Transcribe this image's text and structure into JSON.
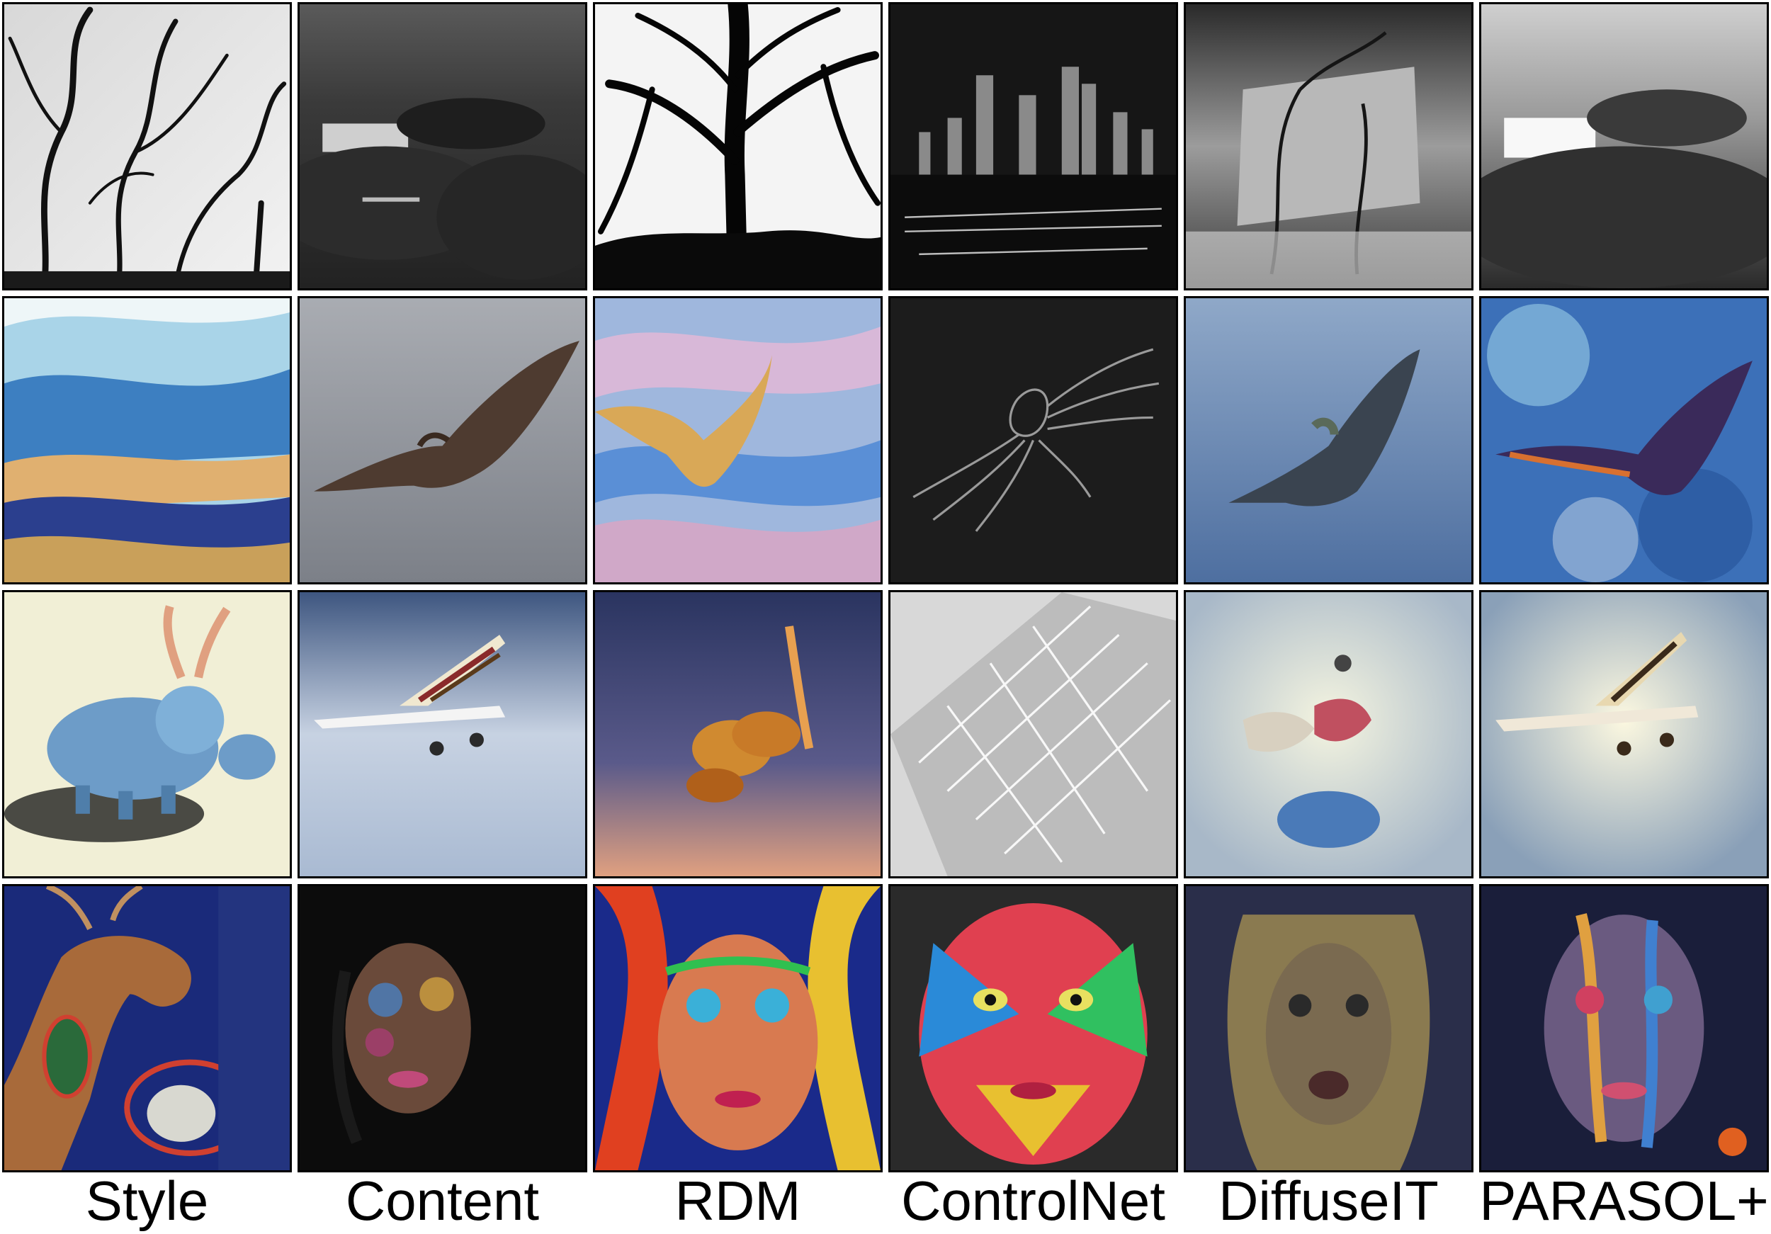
{
  "columns": [
    "Style",
    "Content",
    "RDM",
    "ControlNet",
    "DiffuseIT",
    "PARASOL+"
  ],
  "rows": [
    {
      "cells": [
        {
          "name": "bw-tree-shadows-image"
        },
        {
          "name": "bw-field-billboard-image"
        },
        {
          "name": "bw-tree-silhouette-image"
        },
        {
          "name": "bw-city-skyline-image"
        },
        {
          "name": "bw-wall-branches-image"
        },
        {
          "name": "bw-blurry-field-image"
        }
      ]
    },
    {
      "cells": [
        {
          "name": "blue-landscape-painting-image"
        },
        {
          "name": "pterodactyl-grey-sky-image"
        },
        {
          "name": "painted-bird-pastel-sky-image"
        },
        {
          "name": "sketched-bird-dark-image"
        },
        {
          "name": "pterodactyl-blue-sky-image"
        },
        {
          "name": "pterodactyl-painterly-image"
        }
      ]
    },
    {
      "cells": [
        {
          "name": "tardigrade-illustration-image"
        },
        {
          "name": "model-airplane-sky-image"
        },
        {
          "name": "orange-insect-gradient-image"
        },
        {
          "name": "grey-structure-lines-image"
        },
        {
          "name": "airplane-flower-swirl-image"
        },
        {
          "name": "airplane-bright-sky-image"
        }
      ]
    },
    {
      "cells": [
        {
          "name": "deer-skull-painting-image"
        },
        {
          "name": "painted-face-portrait-image"
        },
        {
          "name": "psychedelic-face-image"
        },
        {
          "name": "colorful-face-paint-image"
        },
        {
          "name": "blurred-face-portrait-image"
        },
        {
          "name": "abstract-paint-face-image"
        }
      ]
    }
  ]
}
